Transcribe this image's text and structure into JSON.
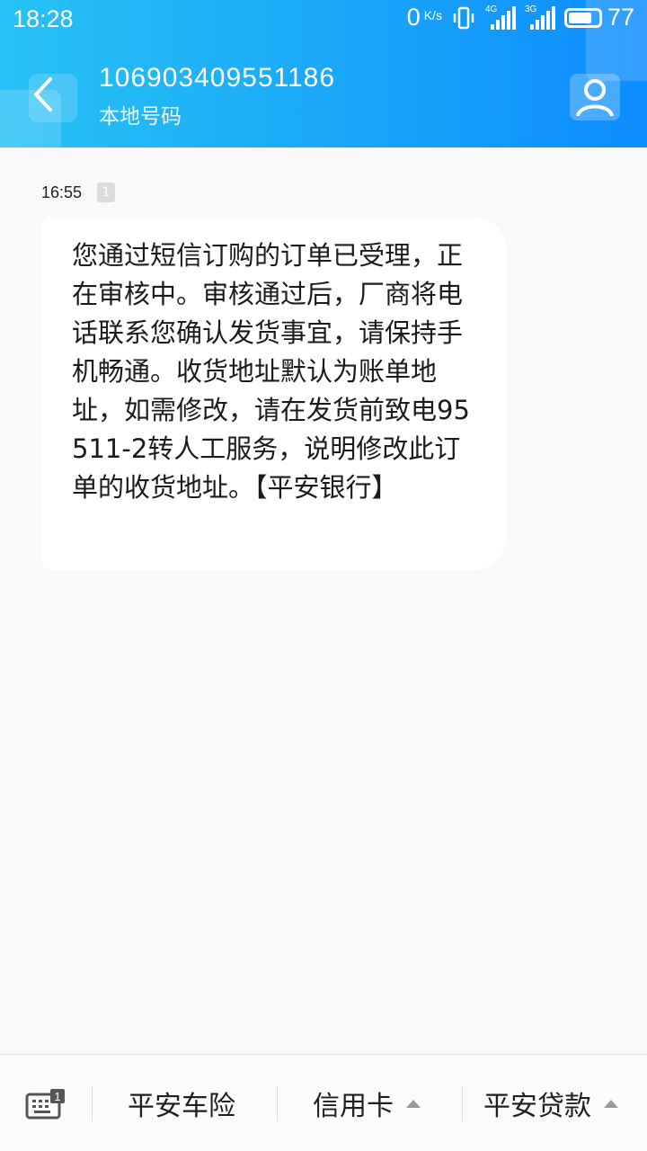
{
  "status_bar": {
    "time": "18:28",
    "net_speed": "0",
    "net_unit": "K/s",
    "signal1_tag": "4G",
    "signal2_tag": "3G",
    "battery": "77"
  },
  "header": {
    "title": "106903409551186",
    "subtitle": "本地号码",
    "back_icon": "chevron-left-icon",
    "contact_icon": "person-icon"
  },
  "message": {
    "time": "16:55",
    "sim_slot": "1",
    "text": "您通过短信订购的订单已受理，正在审核中。审核通过后，厂商将电话联系您确认发货事宜，请保持手机畅通。收货地址默认为账单地址，如需修改，请在发货前致电95511-2转人工服务，说明修改此订单的收货地址。【平安银行】"
  },
  "bottom_menu": {
    "keyboard_icon": "keyboard-icon",
    "keyboard_badge": "1",
    "items": [
      {
        "label": "平安车险"
      },
      {
        "label": "信用卡"
      },
      {
        "label": "平安贷款"
      }
    ]
  },
  "colors": {
    "header_start": "#27c2f5",
    "header_end": "#0d8cff",
    "background": "#f9f9f9",
    "bubble": "#ffffff"
  }
}
